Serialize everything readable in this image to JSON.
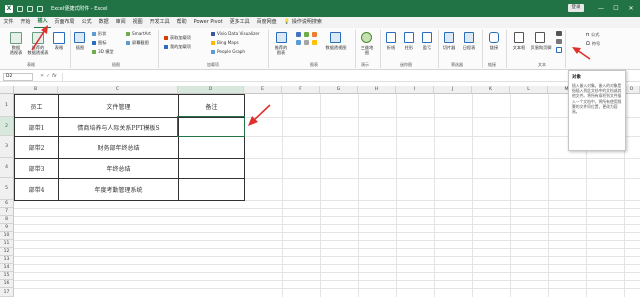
{
  "titlebar": {
    "app_icon": "X",
    "title": "Excel便捷式附件 - Excel",
    "login": "登录",
    "controls": [
      "—",
      "☐",
      "✕"
    ]
  },
  "tabs": [
    "文件",
    "开始",
    "插入",
    "页面布局",
    "公式",
    "数据",
    "审阅",
    "视图",
    "开发工具",
    "帮助",
    "Power Pivot",
    "更多工具",
    "百度网盘",
    "操作说明搜索"
  ],
  "active_tab": "插入",
  "ribbon": {
    "pivot": "数据\n透视表",
    "rec_pivot": "推荐的\n数据透视表",
    "table": "表格",
    "group_tables": "表格",
    "illus": "插图",
    "shapes": "形状",
    "icons": "图标",
    "model3d": "3D 模型",
    "smartart": "SmartArt",
    "screenshot": "屏幕截图",
    "group_illus": "插图",
    "get_addins": "获取加载项",
    "my_addins": "我的加载项",
    "group_addins": "加载项",
    "visio": "Visio Data Visualizer",
    "bing": "Bing Maps",
    "people": "People Graph",
    "rec_charts": "推荐的\n图表",
    "pivot_chart": "数据透视图",
    "group_charts": "图表",
    "map3d": "三维地\n图",
    "group_tour": "演示",
    "line": "折线",
    "column": "柱形",
    "winloss": "盈亏",
    "group_spark": "迷你图",
    "slicer": "切片器",
    "timeline": "日程表",
    "group_filter": "筛选器",
    "link": "链接",
    "group_links": "链接",
    "textbox": "文本框",
    "headerfooter": "页眉和页脚",
    "group_text": "文本",
    "equation": "公式",
    "symbol": "符号"
  },
  "formula_bar": {
    "namebox": "D2",
    "fx": "fx",
    "cancel": "✕",
    "enter": "✓"
  },
  "columns": [
    "B",
    "C",
    "D",
    "E",
    "F",
    "G",
    "H",
    "I",
    "J",
    "K",
    "L",
    "M",
    "N",
    "O",
    "P"
  ],
  "rows": [
    "1",
    "2",
    "3",
    "4",
    "5",
    "6",
    "7",
    "8",
    "9",
    "10",
    "11",
    "12",
    "13",
    "14",
    "15",
    "16",
    "17",
    "18",
    "19"
  ],
  "table": {
    "headers": [
      "员工",
      "文件管理",
      "备注"
    ],
    "rows": [
      [
        "部带1",
        "情商培养与人际关系PPT模板S",
        ""
      ],
      [
        "部带2",
        "财务部年终总结",
        ""
      ],
      [
        "部带3",
        "年终总结",
        ""
      ],
      [
        "部带4",
        "年度考勤管理系统",
        ""
      ]
    ]
  },
  "tooltip": {
    "title": "对象",
    "body": "插入嵌入对象。嵌入的对象是指插入到此文档中的文档或其他文件。将所有乘积到文件插入一个文档中，将所有使用频繁的文件同位置，更改为容易。"
  },
  "colors": {
    "excel_green": "#217346",
    "arrow_red": "#e0302a"
  }
}
